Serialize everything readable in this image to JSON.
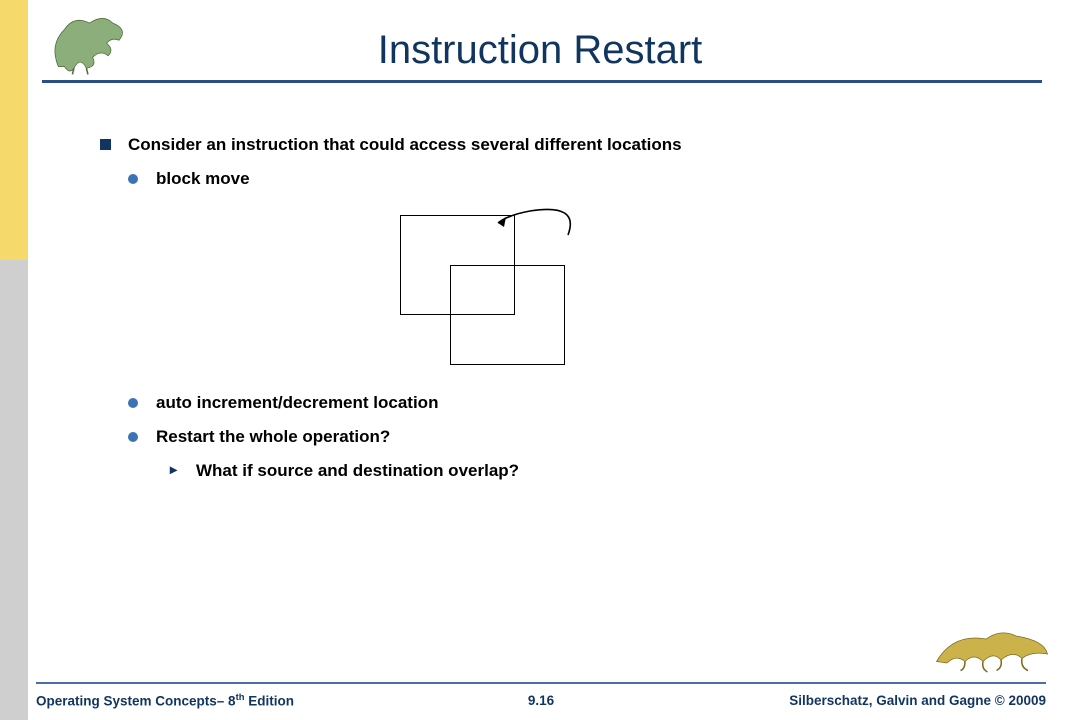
{
  "title": "Instruction Restart",
  "bullets": {
    "l1_1": "Consider an instruction that could access several different locations",
    "l2_1": "block move",
    "l2_2": "auto increment/decrement location",
    "l2_3": "Restart the whole operation?",
    "l3_1": "What if source and destination overlap?"
  },
  "footer": {
    "left_a": "Operating System Concepts– 8",
    "left_sup": "th",
    "left_b": " Edition",
    "center": "9.16",
    "right": "Silberschatz, Galvin and Gagne © 20009"
  }
}
